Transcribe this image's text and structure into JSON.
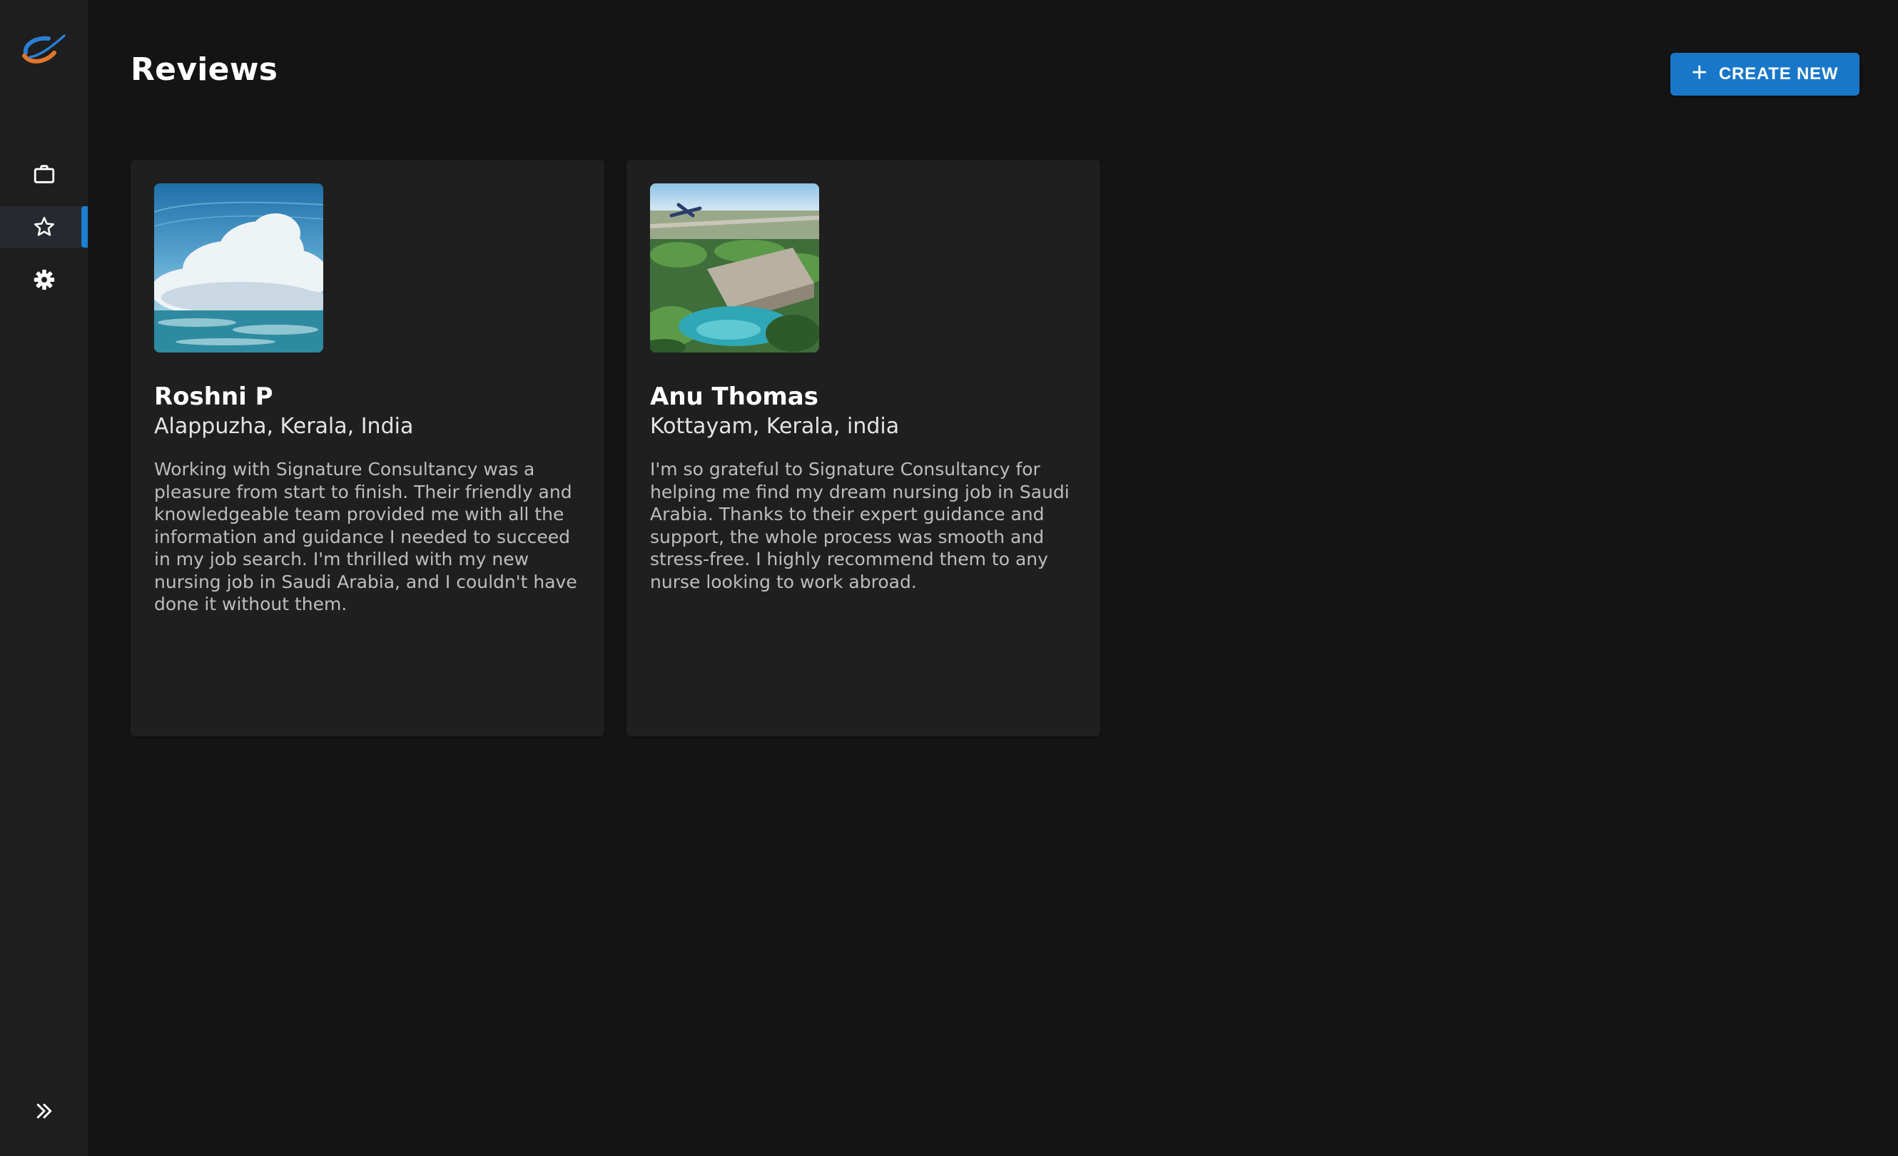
{
  "header": {
    "title": "Reviews",
    "create_button": {
      "icon": "plus-icon",
      "label": "CREATE NEW"
    }
  },
  "sidebar": {
    "logo": "app-logo",
    "items": [
      {
        "icon": "briefcase-icon",
        "name": "jobs",
        "active": false
      },
      {
        "icon": "star-icon",
        "name": "reviews",
        "active": true
      },
      {
        "icon": "gear-icon",
        "name": "settings",
        "active": false
      }
    ],
    "expand_icon": "double-chevron-right-icon"
  },
  "reviews": [
    {
      "name": "Roshni P",
      "location": "Alappuzha, Kerala, India",
      "text": "Working with Signature Consultancy was a pleasure from start to finish. Their friendly and knowledgeable team provided me with all the information and guidance I needed to succeed in my job search. I'm thrilled with my new nursing job in Saudi Arabia, and I couldn't have done it without them."
    },
    {
      "name": "Anu Thomas",
      "location": "Kottayam, Kerala, india",
      "text": "I'm so grateful to Signature Consultancy for helping me find my dream nursing job in Saudi Arabia. Thanks to their expert guidance and support, the whole process was smooth and stress-free. I highly recommend them to any nurse looking to work abroad."
    }
  ],
  "colors": {
    "background": "#141414",
    "sidebar": "#1e1e1e",
    "card": "#1f1f1f",
    "accent": "#1877c9"
  }
}
